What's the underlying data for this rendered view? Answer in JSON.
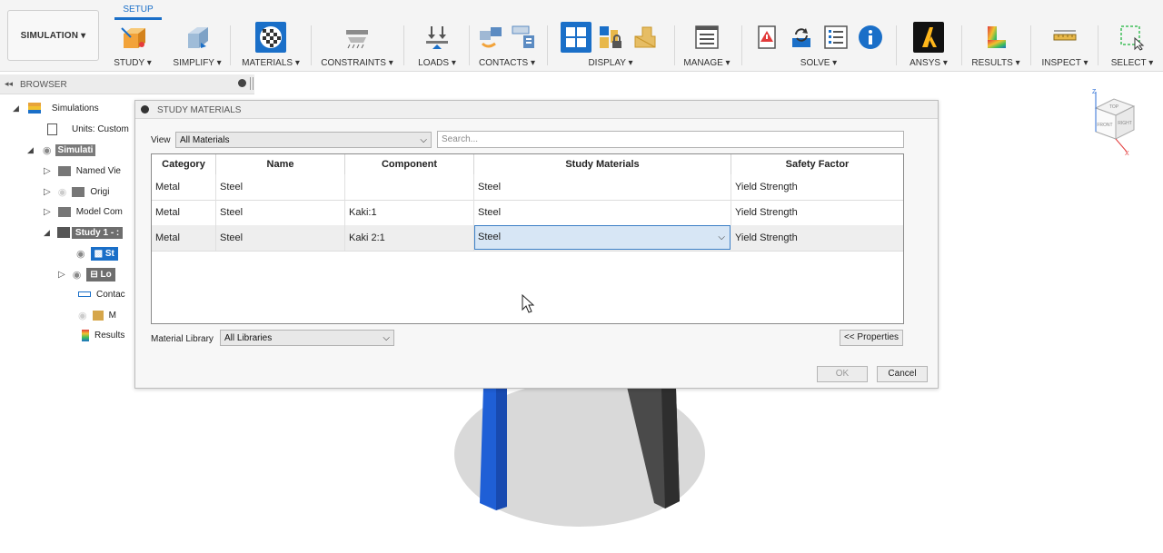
{
  "toolbar": {
    "workspace_label": "SIMULATION ▾",
    "active_tab": "SETUP",
    "groups": [
      {
        "label": "STUDY ▾"
      },
      {
        "label": "SIMPLIFY ▾"
      },
      {
        "label": "MATERIALS ▾"
      },
      {
        "label": "CONSTRAINTS ▾"
      },
      {
        "label": "LOADS ▾"
      },
      {
        "label": "CONTACTS ▾"
      },
      {
        "label": "DISPLAY ▾"
      },
      {
        "label": "MANAGE ▾"
      },
      {
        "label": "SOLVE ▾"
      },
      {
        "label": "ANSYS ▾"
      },
      {
        "label": "RESULTS ▾"
      },
      {
        "label": "INSPECT ▾"
      },
      {
        "label": "SELECT ▾"
      }
    ]
  },
  "browser": {
    "title": "BROWSER",
    "items": [
      {
        "label": "Simulations"
      },
      {
        "label": "Units: Custom"
      },
      {
        "label": "Simulati"
      },
      {
        "label": "Named Vie"
      },
      {
        "label": "Origi"
      },
      {
        "label": "Model Com"
      },
      {
        "label": "Study 1 - :"
      },
      {
        "label": "St"
      },
      {
        "label": "Lo"
      },
      {
        "label": "Contac"
      },
      {
        "label": "M"
      },
      {
        "label": "Results"
      }
    ]
  },
  "dialog": {
    "title": "STUDY MATERIALS",
    "view_label": "View",
    "view_value": "All Materials",
    "search_placeholder": "Search...",
    "columns": [
      "Category",
      "Name",
      "Component",
      "Study Materials",
      "Safety Factor"
    ],
    "rows": [
      {
        "category": "Metal",
        "name": "Steel",
        "component": "",
        "study_material": "Steel",
        "safety_factor": "Yield Strength"
      },
      {
        "category": "Metal",
        "name": "Steel",
        "component": "Kaki:1",
        "study_material": "Steel",
        "safety_factor": "Yield Strength"
      },
      {
        "category": "Metal",
        "name": "Steel",
        "component": "Kaki 2:1",
        "study_material": "Steel",
        "safety_factor": "Yield Strength"
      }
    ],
    "library_label": "Material Library",
    "library_value": "All Libraries",
    "properties_button": "<< Properties",
    "ok_button": "OK",
    "cancel_button": "Cancel"
  },
  "viewcube": {
    "top": "TOP",
    "front": "FRONT",
    "right": "RIGHT",
    "axis_x": "X",
    "axis_z": "Z"
  },
  "colors": {
    "accent": "#1a6fc8",
    "selected_row": "#d7e6f5",
    "part_blue": "#1f5fd6",
    "part_gray": "#4a4a4a"
  }
}
